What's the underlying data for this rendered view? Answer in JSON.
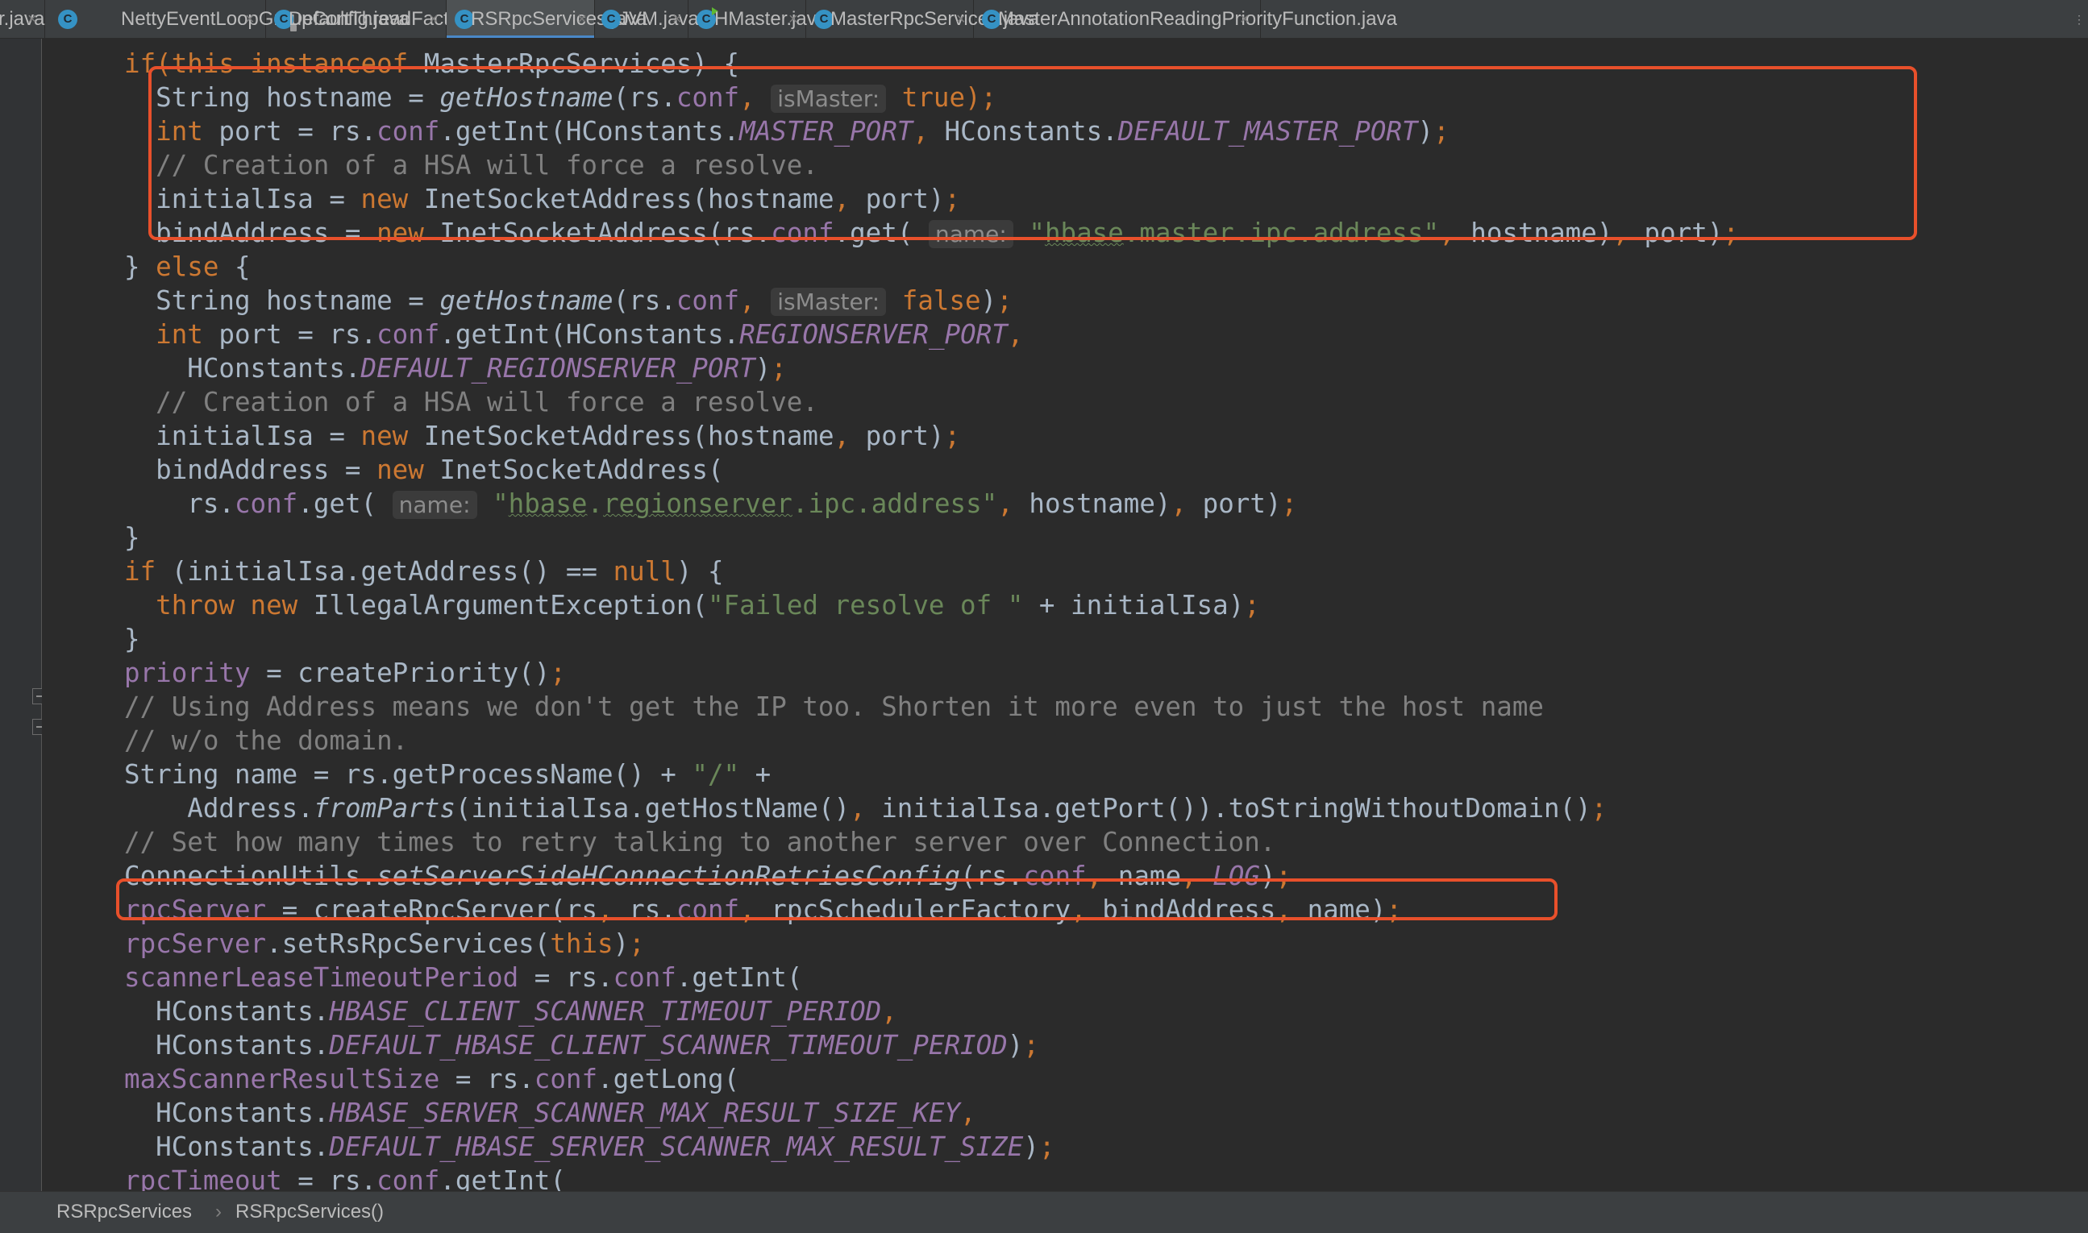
{
  "tabs": [
    {
      "label": "r.java",
      "close": "×",
      "icon": "none",
      "active": false
    },
    {
      "label": "NettyEventLoopGroupConfig.java",
      "close": "×",
      "icon": "class-icon",
      "active": false
    },
    {
      "label": "DefaultThreadFactory.java",
      "close": "×",
      "icon": "class-locked-icon",
      "active": false
    },
    {
      "label": "RSRpcServices.java",
      "close": "×",
      "icon": "class-icon",
      "active": true
    },
    {
      "label": "JVM.java",
      "close": "×",
      "icon": "class-icon",
      "active": false
    },
    {
      "label": "HMaster.java",
      "close": "×",
      "icon": "class-runnable-icon",
      "active": false
    },
    {
      "label": "MasterRpcServices.java",
      "close": "×",
      "icon": "class-icon",
      "active": false
    },
    {
      "label": "MasterAnnotationReadingPriorityFunction.java",
      "close": "×",
      "icon": "class-icon",
      "active": false
    }
  ],
  "tab_icon_glyph": "C",
  "tab_overflow": "⋮",
  "colors": {
    "accent": "#4a88c7",
    "highlight_box": "#e8502b",
    "keyword": "#cc7832",
    "field": "#9876aa",
    "string": "#6a8759",
    "comment": "#808080",
    "text": "#a9b7c6",
    "background": "#2b2b2b"
  },
  "code_lines": [
    [
      [
        "kw",
        "if("
      ],
      [
        "kw",
        "this "
      ],
      [
        "kw",
        "instanceof "
      ],
      [
        "",
        "MasterRpcServices) {"
      ]
    ],
    [
      [
        "",
        "  String hostname = "
      ],
      [
        "it",
        "getHostname"
      ],
      [
        "",
        "(rs."
      ],
      [
        "fld",
        "conf"
      ],
      [
        "kw",
        ", "
      ],
      [
        "hint",
        "isMaster:"
      ],
      [
        "kw",
        " true"
      ],
      [
        "kw",
        ");"
      ]
    ],
    [
      [
        "kw",
        "  int "
      ],
      [
        "",
        "port = rs."
      ],
      [
        "fld",
        "conf"
      ],
      [
        "",
        ".getInt(HConstants."
      ],
      [
        "cst",
        "MASTER_PORT"
      ],
      [
        "kw",
        ", "
      ],
      [
        "",
        "HConstants."
      ],
      [
        "cst",
        "DEFAULT_MASTER_PORT"
      ],
      [
        "",
        ")"
      ],
      [
        "kw",
        ";"
      ]
    ],
    [
      [
        "cmt",
        "  // Creation of a HSA will force a resolve."
      ]
    ],
    [
      [
        "",
        "  initialIsa = "
      ],
      [
        "kw",
        "new "
      ],
      [
        "",
        "InetSocketAddress(hostname"
      ],
      [
        "kw",
        ", "
      ],
      [
        "",
        "port)"
      ],
      [
        "kw",
        ";"
      ]
    ],
    [
      [
        "",
        "  bindAddress = "
      ],
      [
        "kw",
        "new "
      ],
      [
        "",
        "InetSocketAddress(rs."
      ],
      [
        "fld",
        "conf"
      ],
      [
        "",
        ".get( "
      ],
      [
        "hint",
        "name:"
      ],
      [
        "str",
        " \""
      ],
      [
        "strsq",
        "hbase"
      ],
      [
        "str",
        ".master.ipc.address\""
      ],
      [
        "kw",
        ", "
      ],
      [
        "",
        "hostname)"
      ],
      [
        "kw",
        ", "
      ],
      [
        "",
        "port)"
      ],
      [
        "kw",
        ";"
      ]
    ],
    [
      [
        "",
        "} "
      ],
      [
        "kw",
        "else "
      ],
      [
        "",
        "{"
      ]
    ],
    [
      [
        "",
        "  String hostname = "
      ],
      [
        "it",
        "getHostname"
      ],
      [
        "",
        "(rs."
      ],
      [
        "fld",
        "conf"
      ],
      [
        "kw",
        ", "
      ],
      [
        "hint",
        "isMaster:"
      ],
      [
        "kw",
        " false"
      ],
      [
        "",
        ")"
      ],
      [
        "kw",
        ";"
      ]
    ],
    [
      [
        "kw",
        "  int "
      ],
      [
        "",
        "port = rs."
      ],
      [
        "fld",
        "conf"
      ],
      [
        "",
        ".getInt(HConstants."
      ],
      [
        "cst",
        "REGIONSERVER_PORT"
      ],
      [
        "kw",
        ","
      ]
    ],
    [
      [
        "",
        "    HConstants."
      ],
      [
        "cst",
        "DEFAULT_REGIONSERVER_PORT"
      ],
      [
        "",
        ")"
      ],
      [
        "kw",
        ";"
      ]
    ],
    [
      [
        "cmt",
        "  // Creation of a HSA will force a resolve."
      ]
    ],
    [
      [
        "",
        "  initialIsa = "
      ],
      [
        "kw",
        "new "
      ],
      [
        "",
        "InetSocketAddress(hostname"
      ],
      [
        "kw",
        ", "
      ],
      [
        "",
        "port)"
      ],
      [
        "kw",
        ";"
      ]
    ],
    [
      [
        "",
        "  bindAddress = "
      ],
      [
        "kw",
        "new "
      ],
      [
        "",
        "InetSocketAddress("
      ]
    ],
    [
      [
        "",
        "    rs."
      ],
      [
        "fld",
        "conf"
      ],
      [
        "",
        ".get( "
      ],
      [
        "hint",
        "name:"
      ],
      [
        "str",
        " \""
      ],
      [
        "strsq",
        "hbase"
      ],
      [
        "str",
        "."
      ],
      [
        "strsq",
        "regionserver"
      ],
      [
        "str",
        ".ipc.address\""
      ],
      [
        "kw",
        ", "
      ],
      [
        "",
        "hostname)"
      ],
      [
        "kw",
        ", "
      ],
      [
        "",
        "port)"
      ],
      [
        "kw",
        ";"
      ]
    ],
    [
      [
        "",
        "}"
      ]
    ],
    [
      [
        "kw",
        "if "
      ],
      [
        "",
        "(initialIsa.getAddress() == "
      ],
      [
        "kw",
        "null"
      ],
      [
        "",
        ") {"
      ]
    ],
    [
      [
        "kw",
        "  throw new "
      ],
      [
        "",
        "IllegalArgumentException("
      ],
      [
        "str",
        "\"Failed resolve of \""
      ],
      [
        "",
        " + initialIsa)"
      ],
      [
        "kw",
        ";"
      ]
    ],
    [
      [
        "",
        "}"
      ]
    ],
    [
      [
        "fld",
        "priority"
      ],
      [
        "",
        " = createPriority()"
      ],
      [
        "kw",
        ";"
      ]
    ],
    [
      [
        "cmt",
        "// Using Address means we don't get the IP too. Shorten it more even to just the host name"
      ]
    ],
    [
      [
        "cmt",
        "// w/o the domain."
      ]
    ],
    [
      [
        "",
        "String name = rs.getProcessName() + "
      ],
      [
        "str",
        "\"/\""
      ],
      [
        "",
        " +"
      ]
    ],
    [
      [
        "",
        "    Address."
      ],
      [
        "it",
        "fromParts"
      ],
      [
        "",
        "(initialIsa.getHostName()"
      ],
      [
        "kw",
        ", "
      ],
      [
        "",
        "initialIsa.getPort()).toStringWithoutDomain()"
      ],
      [
        "kw",
        ";"
      ]
    ],
    [
      [
        "cmt",
        "// Set how many times to retry talking to another server over Connection."
      ]
    ],
    [
      [
        "",
        "ConnectionUtils."
      ],
      [
        "it",
        "setServerSideHConnectionRetriesConfig"
      ],
      [
        "",
        "(rs."
      ],
      [
        "fld",
        "conf"
      ],
      [
        "kw",
        ", "
      ],
      [
        "",
        "name"
      ],
      [
        "kw",
        ", "
      ],
      [
        "cst",
        "LOG"
      ],
      [
        "",
        ")"
      ],
      [
        "kw",
        ";"
      ]
    ],
    [
      [
        "fld",
        "rpcServer"
      ],
      [
        "",
        " = createRpcServer(rs"
      ],
      [
        "kw",
        ", "
      ],
      [
        "",
        "rs."
      ],
      [
        "fld",
        "conf"
      ],
      [
        "kw",
        ", "
      ],
      [
        "",
        "rpcSchedulerFactory"
      ],
      [
        "kw",
        ", "
      ],
      [
        "",
        "bindAddress"
      ],
      [
        "kw",
        ", "
      ],
      [
        "",
        "name)"
      ],
      [
        "kw",
        ";"
      ]
    ],
    [
      [
        "fld",
        "rpcServer"
      ],
      [
        "",
        ".setRsRpcServices("
      ],
      [
        "kw",
        "this"
      ],
      [
        "",
        ")"
      ],
      [
        "kw",
        ";"
      ]
    ],
    [
      [
        "fld",
        "scannerLeaseTimeoutPeriod"
      ],
      [
        "",
        " = rs."
      ],
      [
        "fld",
        "conf"
      ],
      [
        "",
        ".getInt("
      ]
    ],
    [
      [
        "",
        "  HConstants."
      ],
      [
        "cst",
        "HBASE_CLIENT_SCANNER_TIMEOUT_PERIOD"
      ],
      [
        "kw",
        ","
      ]
    ],
    [
      [
        "",
        "  HConstants."
      ],
      [
        "cst",
        "DEFAULT_HBASE_CLIENT_SCANNER_TIMEOUT_PERIOD"
      ],
      [
        "",
        ")"
      ],
      [
        "kw",
        ";"
      ]
    ],
    [
      [
        "fld",
        "maxScannerResultSize"
      ],
      [
        "",
        " = rs."
      ],
      [
        "fld",
        "conf"
      ],
      [
        "",
        ".getLong("
      ]
    ],
    [
      [
        "",
        "  HConstants."
      ],
      [
        "cst",
        "HBASE_SERVER_SCANNER_MAX_RESULT_SIZE_KEY"
      ],
      [
        "kw",
        ","
      ]
    ],
    [
      [
        "",
        "  HConstants."
      ],
      [
        "cst",
        "DEFAULT_HBASE_SERVER_SCANNER_MAX_RESULT_SIZE"
      ],
      [
        "",
        ")"
      ],
      [
        "kw",
        ";"
      ]
    ],
    [
      [
        "fld",
        "rpcTimeout"
      ],
      [
        "",
        " = rs."
      ],
      [
        "fld",
        "conf"
      ],
      [
        "",
        ".getInt("
      ]
    ]
  ],
  "breadcrumb": {
    "class_name": "RSRpcServices",
    "separator": "›",
    "method_name": "RSRpcServices()"
  }
}
